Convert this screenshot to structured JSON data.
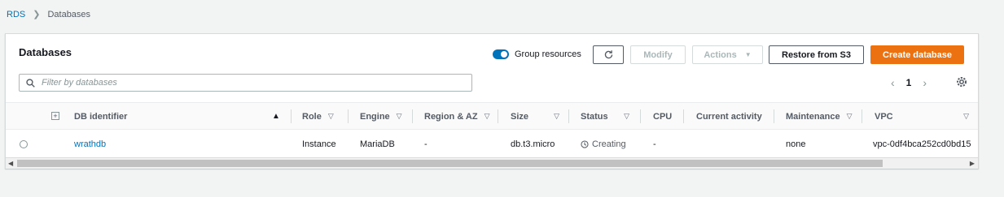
{
  "breadcrumb": {
    "root": "RDS",
    "current": "Databases"
  },
  "panel": {
    "title": "Databases",
    "group_resources_label": "Group resources",
    "buttons": {
      "modify": "Modify",
      "actions": "Actions",
      "restore": "Restore from S3",
      "create": "Create database"
    },
    "search_placeholder": "Filter by databases",
    "page_number": "1"
  },
  "table": {
    "columns": [
      "DB identifier",
      "Role",
      "Engine",
      "Region & AZ",
      "Size",
      "Status",
      "CPU",
      "Current activity",
      "Maintenance",
      "VPC"
    ],
    "rows": [
      {
        "db_identifier": "wrathdb",
        "role": "Instance",
        "engine": "MariaDB",
        "region_az": "-",
        "size": "db.t3.micro",
        "status": "Creating",
        "cpu": "-",
        "current_activity": "",
        "maintenance": "none",
        "vpc": "vpc-0df4bca252cd0bd15"
      }
    ]
  },
  "colors": {
    "accent": "#0073bb",
    "primary_button": "#ec7211"
  },
  "icons": [
    "chevron-right-icon",
    "toggle-on-icon",
    "refresh-icon",
    "caret-down-icon",
    "search-icon",
    "chevron-left-icon",
    "gear-icon",
    "expand-icon",
    "sort-asc-icon",
    "sort-desc-icon",
    "radio-icon",
    "clock-icon"
  ]
}
